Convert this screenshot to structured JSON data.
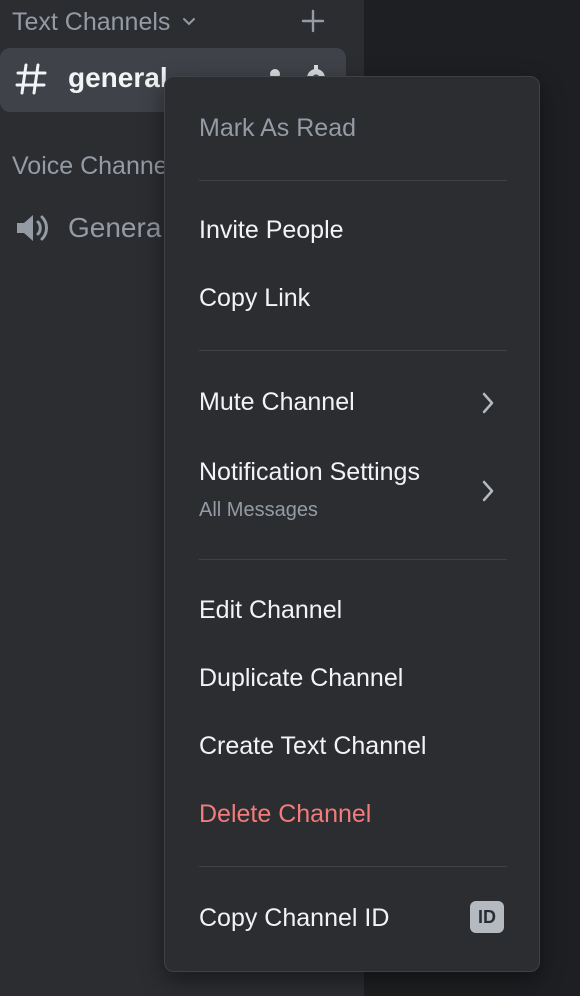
{
  "sidebar": {
    "text_category": "Text Channels",
    "text_channel_name": "general",
    "voice_category": "Voice Channe",
    "voice_channel_name": "Genera"
  },
  "context_menu": {
    "mark_as_read": "Mark As Read",
    "invite_people": "Invite People",
    "copy_link": "Copy Link",
    "mute_channel": "Mute Channel",
    "notification_settings": "Notification Settings",
    "notification_value": "All Messages",
    "edit_channel": "Edit Channel",
    "duplicate_channel": "Duplicate Channel",
    "create_text_channel": "Create Text Channel",
    "delete_channel": "Delete Channel",
    "copy_channel_id": "Copy Channel ID",
    "id_badge": "ID"
  },
  "colors": {
    "sidebar_bg": "#2b2d31",
    "menu_bg": "#2b2d31",
    "selected_row": "#404249",
    "danger": "#f27b7b",
    "muted_text": "#949ba4"
  }
}
